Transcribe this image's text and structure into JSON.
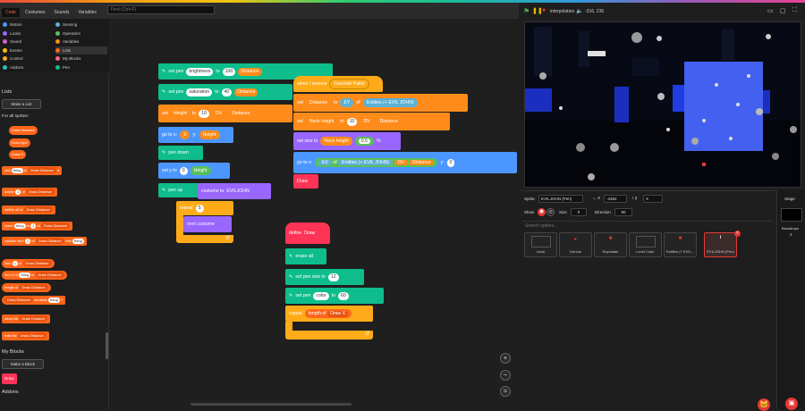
{
  "topbar": {
    "tabs": [
      "Code",
      "Costumes",
      "Sounds",
      "Variables"
    ],
    "find_placeholder": "Find (Ctrl+F)"
  },
  "categories": [
    {
      "label": "Motion",
      "color": "#4c97ff"
    },
    {
      "label": "Sensing",
      "color": "#5cb1d6"
    },
    {
      "label": "Looks",
      "color": "#9966ff"
    },
    {
      "label": "Operators",
      "color": "#59c059"
    },
    {
      "label": "Sound",
      "color": "#cf63cf"
    },
    {
      "label": "Variables",
      "color": "#ff8c1a"
    },
    {
      "label": "Events",
      "color": "#ffbf00"
    },
    {
      "label": "Lists",
      "color": "#ff661a"
    },
    {
      "label": "Control",
      "color": "#ffab19"
    },
    {
      "label": "My Blocks",
      "color": "#ff6680"
    },
    {
      "label": "Addons",
      "color": "#29beb8"
    },
    {
      "label": "Pen",
      "color": "#0fbd8c"
    }
  ],
  "add_extension": "Add Extension",
  "palette": {
    "lists_heading": "Lists",
    "make_list": "Make a List",
    "for_all": "For all sprites:",
    "list_reporters": [
      "Draw Distance",
      "Draw type",
      "Draw X"
    ],
    "blocks": {
      "add": [
        "add",
        "thing",
        "to",
        "Draw Distance"
      ],
      "delete": [
        "delete",
        "1",
        "of",
        "Draw Distance"
      ],
      "delete_all": [
        "delete all of",
        "Draw Distance"
      ],
      "insert": [
        "insert",
        "thing",
        "at",
        "1",
        "of",
        "Draw Distance"
      ],
      "replace": [
        "replace item",
        "1",
        "of",
        "Draw Distance",
        "with",
        "thing"
      ],
      "item": [
        "item",
        "1",
        "of",
        "Draw Distance"
      ],
      "item_num": [
        "item # of",
        "thing",
        "in",
        "Draw Distance"
      ],
      "length": [
        "length of",
        "Draw Distance"
      ],
      "contains": [
        "Draw Distance",
        "contains",
        "thing",
        "?"
      ],
      "show": [
        "show list",
        "Draw Distance"
      ],
      "hide": [
        "hide list",
        "Draw Distance"
      ]
    },
    "myblocks_heading": "My Blocks",
    "make_block": "Make a Block",
    "draw_block": "Draw",
    "addons_heading": "Addons"
  },
  "script1": {
    "b1": [
      "set pen",
      "brightness",
      "to",
      "100",
      "Distance"
    ],
    "b2": [
      "set pen",
      "saturation",
      "to",
      "40",
      "Distance"
    ],
    "b3": [
      "set",
      "Height",
      "to",
      "10",
      "DV",
      "Distance"
    ],
    "b4": [
      "go to x:",
      "X",
      "y:",
      "Height"
    ],
    "b5": [
      "pen down"
    ],
    "b6": [
      "set y to",
      "0",
      "Height"
    ],
    "b7": [
      "pen up",
      "costume to",
      "EVILJOHN"
    ],
    "b8": [
      "repeat",
      "5"
    ],
    "b9": [
      "next costume"
    ]
  },
  "script2": {
    "b1": [
      "when I receive",
      "Override Pallet"
    ],
    "b2": [
      "set",
      "Distance",
      "to",
      "EY",
      "of",
      "Entities (+ EVIL JOHN)"
    ],
    "b3": [
      "set",
      "Neck height",
      "to",
      "10",
      "DV",
      "Distance"
    ],
    "b4": [
      "set size to",
      "Neck height",
      "0.5",
      "%"
    ],
    "b5": [
      "go to x:",
      "EX",
      "of",
      "Entities (+ EVIL JOHN)",
      "DV",
      "Distance",
      "y:",
      "0"
    ],
    "b6": [
      "Draw"
    ]
  },
  "script3": {
    "hat": [
      "define",
      "Draw"
    ],
    "b1": [
      "erase all"
    ],
    "b2": [
      "set pen size to",
      "12"
    ],
    "b3": [
      "set pen",
      "color",
      "to",
      "60"
    ],
    "b4": [
      "repeat",
      "length of",
      "Draw X"
    ]
  },
  "zoom": [
    "+",
    "−",
    "="
  ],
  "stage": {
    "title": "interpolation",
    "coords": "-316, 236"
  },
  "sprite_info": {
    "sprite_label": "Sprite",
    "sprite_name": "EVILJOHN (Pen)",
    "x": "-3362",
    "y": "X",
    "show_label": "Show",
    "size_label": "Size",
    "size": "0",
    "direction_label": "Direction",
    "direction": "90",
    "search": "Search sprites..."
  },
  "sprites": [
    "Level",
    "Dennis",
    "Raycaster",
    "Level Color",
    "Entities (+ EVIL...",
    "EVILJOHN (Pen)"
  ],
  "stage_col": {
    "label": "Stage",
    "backdrops_label": "Backdrops",
    "backdrops": "2"
  }
}
